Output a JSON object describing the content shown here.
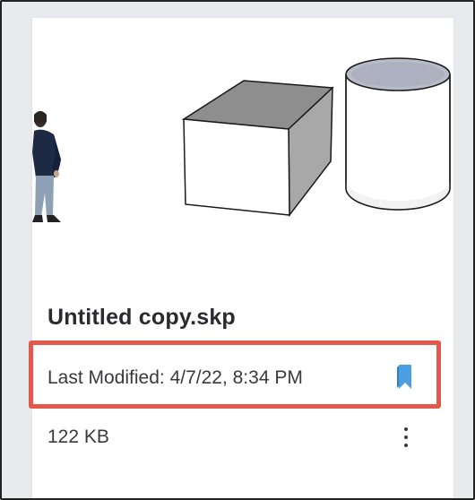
{
  "file": {
    "name": "Untitled copy.skp",
    "last_modified": "Last Modified: 4/7/22, 8:34 PM",
    "size": "122 KB"
  },
  "icons": {
    "bookmark": "bookmark-icon",
    "more": "more-vertical-icon"
  },
  "colors": {
    "highlight": "#e2584d",
    "bookmark": "#4b9ee0",
    "title": "#2b2b2f"
  }
}
